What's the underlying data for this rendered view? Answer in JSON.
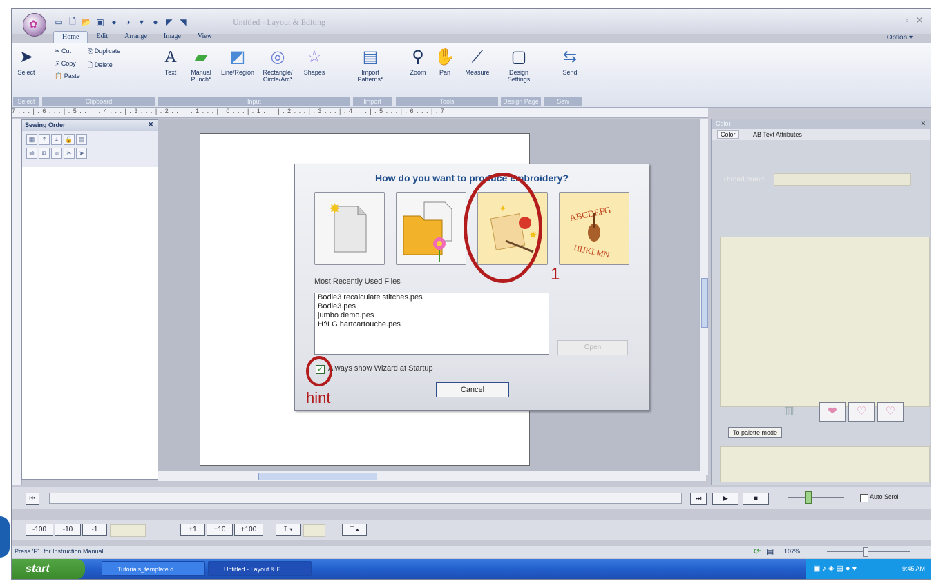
{
  "window": {
    "title": "Untitled - Layout & Editing",
    "controls": [
      "–",
      "▫",
      "✕"
    ]
  },
  "ribbon": {
    "tabs": [
      "Home",
      "Edit",
      "Arrange",
      "Image",
      "View"
    ],
    "option_label": "Option",
    "select_label": "Select",
    "clipboard": {
      "cut": "Cut",
      "copy": "Copy",
      "paste": "Paste",
      "duplicate": "Duplicate",
      "delete": "Delete"
    },
    "buttons": {
      "text": "Text",
      "manual_punch": "Manual Punch*",
      "line_region": "Line/Region",
      "rect_circle": "Rectangle/ Circle/Arc*",
      "shapes": "Shapes",
      "import_patterns": "Import Patterns*",
      "zoom": "Zoom",
      "pan": "Pan",
      "measure": "Measure",
      "design_settings": "Design Settings",
      "send": "Send"
    },
    "groups": [
      "Select",
      "Clipboard",
      "Input",
      "Import",
      "Tools",
      "Design Page",
      "Sew"
    ]
  },
  "ruler_text": "7 . . . | . 6 . . . | . 5 . . . | . 4 . . . | . 3 . . . | . 2 . . . | . 1 . . . | . 0 . . . | . 1 . . . | . 2 . . . | . 3 . . . | . 4 . . . | . 5 . . . | . 6 . . . | . 7",
  "sewing_panel": {
    "title": "Sewing Order",
    "close": "✕"
  },
  "color_panel": {
    "title": "Color",
    "close": "✕",
    "tabs": [
      "Color",
      "AB Text Attributes"
    ],
    "thread_label": "Thread brand",
    "palette_button": "To palette mode"
  },
  "dialog": {
    "title": "How do you want to produce embroidery?",
    "choices": [
      "New design",
      "Open file",
      "Photo stitch wizard",
      "Text / ABCDEFG HIJKLMN"
    ],
    "choice_glyphs": [
      "🗋",
      "📂",
      "✨",
      "ABCDEFG"
    ],
    "mru_label": "Most Recently Used Files",
    "mru_files": [
      "Bodie3 recalculate stitches.pes",
      "Bodie3.pes",
      "jumbo demo.pes",
      "H:\\LG hartcartouche.pes"
    ],
    "open_button": "Open",
    "wizard_checkbox_label": "Always show Wizard at Startup",
    "cancel_button": "Cancel"
  },
  "annotations": {
    "number": "1",
    "hint": "hint",
    "color": "#b21c1c"
  },
  "timeline": {
    "auto_scroll": "Auto Scroll"
  },
  "stitch_buttons": [
    "-100",
    "-10",
    "-1",
    "+1",
    "+10",
    "+100"
  ],
  "statusbar": {
    "text": "Press 'F1' for Instruction Manual.",
    "zoom": "107%"
  },
  "taskbar": {
    "start": "start",
    "tasks": [
      "Tutorials_template.d...",
      "Untitled - Layout & E..."
    ],
    "time": "9:45 AM"
  }
}
